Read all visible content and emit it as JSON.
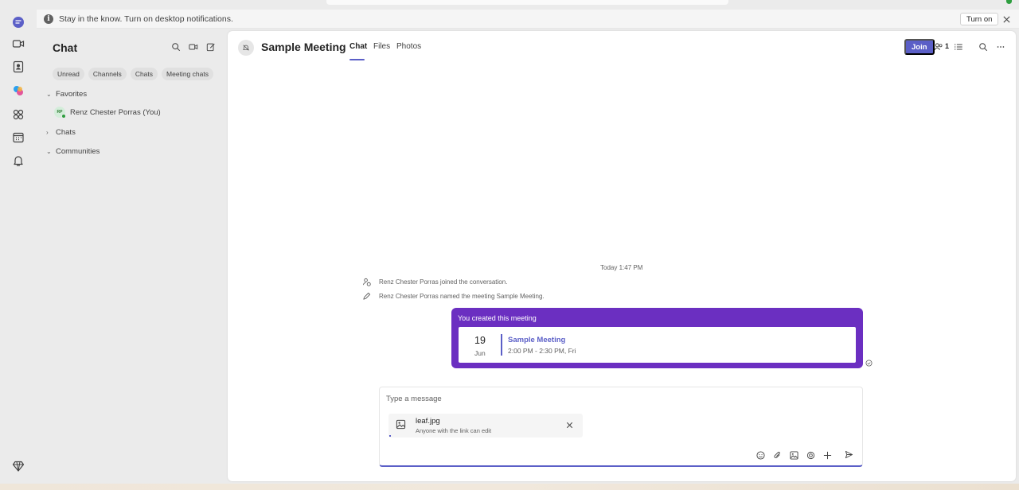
{
  "notification": {
    "text": "Stay in the know. Turn on desktop notifications.",
    "turn_on_label": "Turn on"
  },
  "rail": {
    "items": [
      "copilot-icon",
      "meet-video-icon",
      "contacts-icon",
      "copilot-colorful-icon",
      "apps-icon",
      "calendar-icon",
      "activity-bell-icon",
      "premium-diamond-icon"
    ]
  },
  "chat_pane": {
    "title": "Chat",
    "filters": [
      "Unread",
      "Channels",
      "Chats",
      "Meeting chats"
    ],
    "favorites_label": "Favorites",
    "favorite_item": "Renz Chester Porras (You)",
    "favorite_avatar_initials": "RP",
    "chats_label": "Chats",
    "communities_label": "Communities"
  },
  "header": {
    "meeting_title": "Sample Meeting",
    "tabs": [
      "Chat",
      "Files",
      "Photos"
    ],
    "join_label": "Join",
    "participants_count": "1"
  },
  "conversation": {
    "timestamp": "Today 1:47 PM",
    "system_messages": [
      "Renz Chester Porras joined the conversation.",
      "Renz Chester Porras named the meeting Sample Meeting."
    ],
    "card": {
      "heading": "You created this meeting",
      "day": "19",
      "month": "Jun",
      "title": "Sample Meeting",
      "time": "2:00 PM - 2:30 PM, Fri"
    }
  },
  "composer": {
    "placeholder": "Type a message",
    "attachment": {
      "file_name": "leaf.jpg",
      "permission": "Anyone with the link can edit"
    }
  },
  "colors": {
    "accent": "#5b5fc7",
    "card": "#6b2fc1",
    "presence": "#2e9e3f"
  }
}
